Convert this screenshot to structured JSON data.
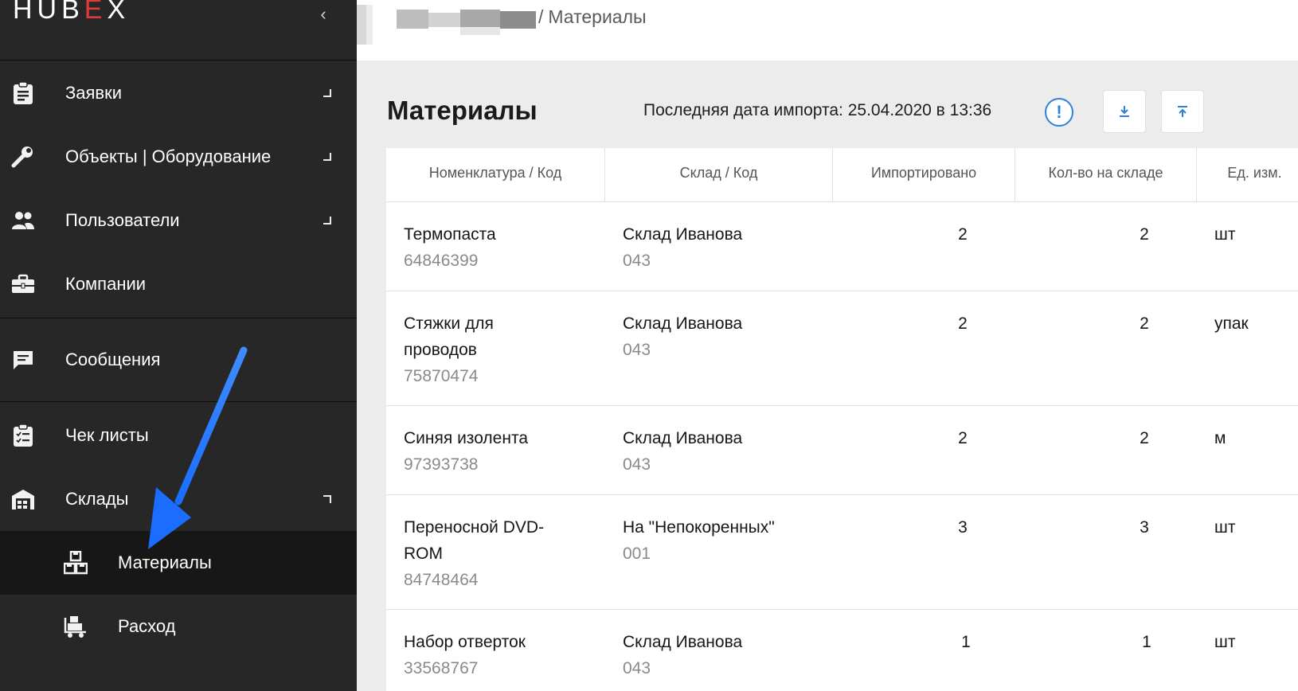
{
  "app": {
    "logo_left": "HUB",
    "logo_e": "E",
    "logo_right": "X"
  },
  "sidebar": {
    "collapse_glyph": "‹",
    "items": [
      {
        "label": "Заявки",
        "icon": "clipboard-icon"
      },
      {
        "label": "Объекты | Оборудование",
        "icon": "wrench-icon"
      },
      {
        "label": "Пользователи",
        "icon": "users-icon"
      },
      {
        "label": "Компании",
        "icon": "briefcase-icon"
      },
      {
        "label": "Сообщения",
        "icon": "message-icon"
      },
      {
        "label": "Чек листы",
        "icon": "checklist-icon"
      },
      {
        "label": "Склады",
        "icon": "warehouse-icon"
      },
      {
        "label": "Материалы",
        "icon": "boxes-icon"
      },
      {
        "label": "Расход",
        "icon": "cart-icon"
      }
    ]
  },
  "header": {
    "breadcrumb_sep": "/",
    "breadcrumb_current": "Материалы"
  },
  "main": {
    "title": "Материалы",
    "import_info": "Последняя дата импорта: 25.04.2020 в 13:36",
    "info_glyph": "!",
    "colors": {
      "accent": "#2f7fdc",
      "brand_red": "#e03a3a",
      "sidebar": "#272727"
    }
  },
  "table": {
    "columns": [
      "Номенклатура / Код",
      "Склад / Код",
      "Импортировано",
      "Кол-во на складе",
      "Ед. изм."
    ],
    "rows": [
      {
        "name": [
          "Термопаста"
        ],
        "code": "64846399",
        "warehouse": "Склад Иванова",
        "wh_code": "043",
        "imported": "2",
        "stock": "2",
        "unit": "шт"
      },
      {
        "name": [
          "Стяжки для",
          "проводов"
        ],
        "code": "75870474",
        "warehouse": "Склад Иванова",
        "wh_code": "043",
        "imported": "2",
        "stock": "2",
        "unit": "упак"
      },
      {
        "name": [
          "Синяя изолента"
        ],
        "code": "97393738",
        "warehouse": "Склад Иванова",
        "wh_code": "043",
        "imported": "2",
        "stock": "2",
        "unit": "м"
      },
      {
        "name": [
          "Переносной DVD-",
          "ROM"
        ],
        "code": "84748464",
        "warehouse": "На \"Непокоренных\"",
        "wh_code": "001",
        "imported": "3",
        "stock": "3",
        "unit": "шт"
      },
      {
        "name": [
          "Набор отверток"
        ],
        "code": "33568767",
        "warehouse": "Склад Иванова",
        "wh_code": "043",
        "imported": "1",
        "stock": "1",
        "unit": "шт"
      }
    ]
  }
}
